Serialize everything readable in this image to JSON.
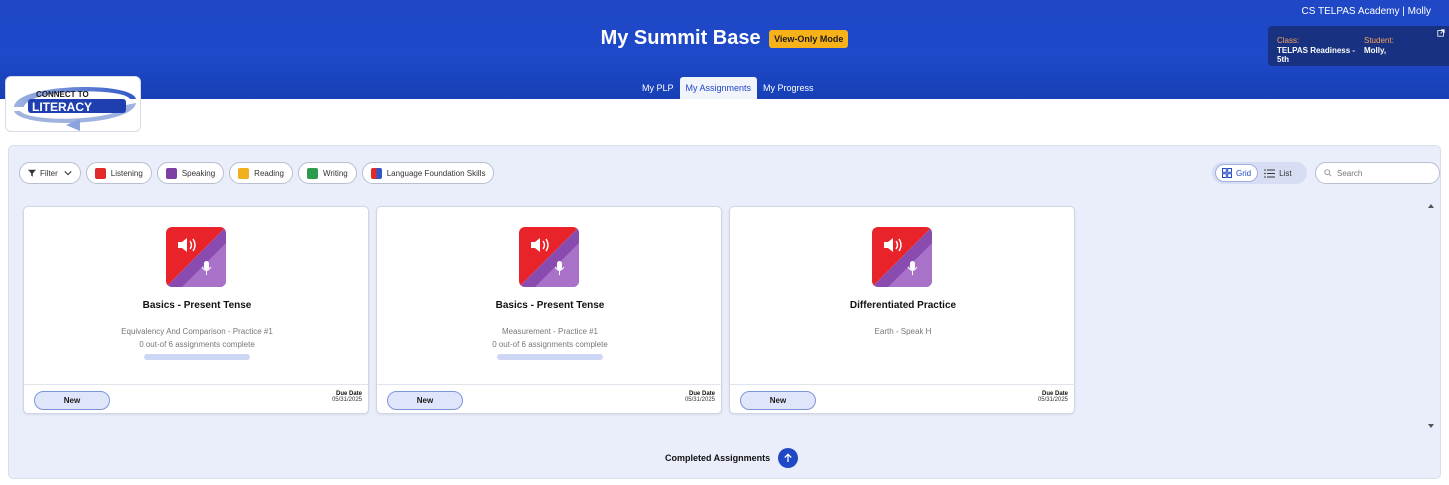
{
  "header": {
    "school_user": "CS TELPAS Academy | Molly",
    "title": "My Summit Base",
    "mode_badge": "View-Only Mode",
    "info": {
      "class_label": "Class:",
      "class_value": "TELPAS Readiness - 5th",
      "student_label": "Student:",
      "student_value": "Molly,"
    }
  },
  "nav": {
    "tabs": [
      {
        "label": "My PLP",
        "active": false
      },
      {
        "label": "My Assignments",
        "active": true
      },
      {
        "label": "My Progress",
        "active": false
      }
    ]
  },
  "logo": {
    "line1": "CONNECT TO",
    "line2": "LITERACY"
  },
  "filters": {
    "filter_label": "Filter",
    "chips": [
      {
        "label": "Listening",
        "color": "#e02a2a"
      },
      {
        "label": "Speaking",
        "color": "#7b3fa5"
      },
      {
        "label": "Reading",
        "color": "#f2b01e"
      },
      {
        "label": "Writing",
        "color": "#2c9b4b"
      },
      {
        "label": "Language Foundation Skills",
        "color": "#5a4fc9"
      }
    ]
  },
  "view": {
    "grid_label": "Grid",
    "list_label": "List"
  },
  "search": {
    "placeholder": "Search"
  },
  "cards": [
    {
      "title": "Basics - Present Tense",
      "subtitle": "Equivalency And Comparison - Practice #1",
      "count": "0 out-of 6 assignments complete",
      "progress": 0,
      "status": "New",
      "due_label": "Due Date",
      "due_date": "05/31/2025"
    },
    {
      "title": "Basics - Present Tense",
      "subtitle": "Measurement - Practice #1",
      "count": "0 out-of 6 assignments complete",
      "progress": 0,
      "status": "New",
      "due_label": "Due Date",
      "due_date": "05/31/2025"
    },
    {
      "title": "Differentiated Practice",
      "subtitle": "Earth - Speak H",
      "count": "",
      "progress": null,
      "status": "New",
      "due_label": "Due Date",
      "due_date": "05/31/2025"
    }
  ],
  "completed": {
    "label": "Completed Assignments"
  },
  "colors": {
    "brand_blue": "#1f47c6",
    "badge": "#f7b21a",
    "listening_red": "#e8232a",
    "speaking_purple": "#8a4bb0"
  }
}
